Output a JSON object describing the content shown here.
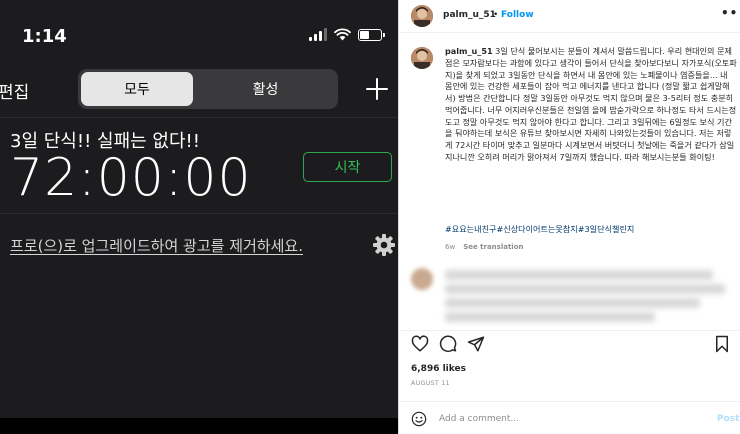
{
  "phone": {
    "status": {
      "time": "1:14"
    },
    "toolbar": {
      "edit_label": "편집",
      "segments": [
        "모두",
        "활성"
      ],
      "add_icon": "plus-icon"
    },
    "timer": {
      "title": "3일 단식!! 실패는 없다!!",
      "value": "72:00:00",
      "start_label": "시작",
      "accent_color": "#32c05a"
    },
    "upgrade_text": "프로(으)로 업그레이드하여 광고를 제거하세요.",
    "settings_icon": "gear-icon"
  },
  "instagram": {
    "header": {
      "username": "palm_u_51",
      "dot": "•",
      "follow_label": "Follow",
      "more_icon": "more-horizontal-icon",
      "follow_color": "#0095f6"
    },
    "caption": {
      "username": "palm_u_51",
      "text": "3일 단식 물어보시는 분들이 계셔서 말씀드립니다. 우리 현대인의 문제점은 모자람보다는 과함에 있다고 생각이 들어서 단식을 찾아보다보니 자가포식(오토파지)을 찾게 되었고 3일동안 단식을 하면서 내 몸안에 있는 노폐물이나 염증들을... 내 몸안에 있는 건강한 세포들이 잡아 먹고 에너지를 낸다고 합니다 (정말 짧고 쉽게말해서) 방법은 간단합니다 정말 3일동안 아무것도 먹지 않으며 물은 3-5리터 정도 충분히 먹어줍니다. 너무 어지러우신분들은 천일염 을에 밥숟가락으로 하나정도 타서 드시는정도고 정말 아무것도 먹지 않아야 한다고 합니다. 그리고 3일뒤에는 6일정도 보식 기간을 둬야하는데 보식은 유튜브 찾아보시면 자세히 나와있는것들이 있습니다. 저는 저렇게 72시간 타이머 맞추고 일분마다 시계보면서 버텻더니 첫날에는 죽을거 같다가 삼일지나니깐 오히려 머리가 맑아져서 7일까지 했습니다. 따라 해보시는분들 화이팅!",
      "hashtags": "#요요는내친구#신상다이어트는못참지#3일단식챌린지",
      "age": "6w",
      "see_translation": "See translation"
    },
    "actions": {
      "icons": [
        "heart-icon",
        "comment-icon",
        "share-icon",
        "bookmark-icon"
      ]
    },
    "likes": "6,896 likes",
    "date": "AUGUST 11",
    "comment": {
      "placeholder": "Add a comment...",
      "post_label": "Post"
    }
  }
}
